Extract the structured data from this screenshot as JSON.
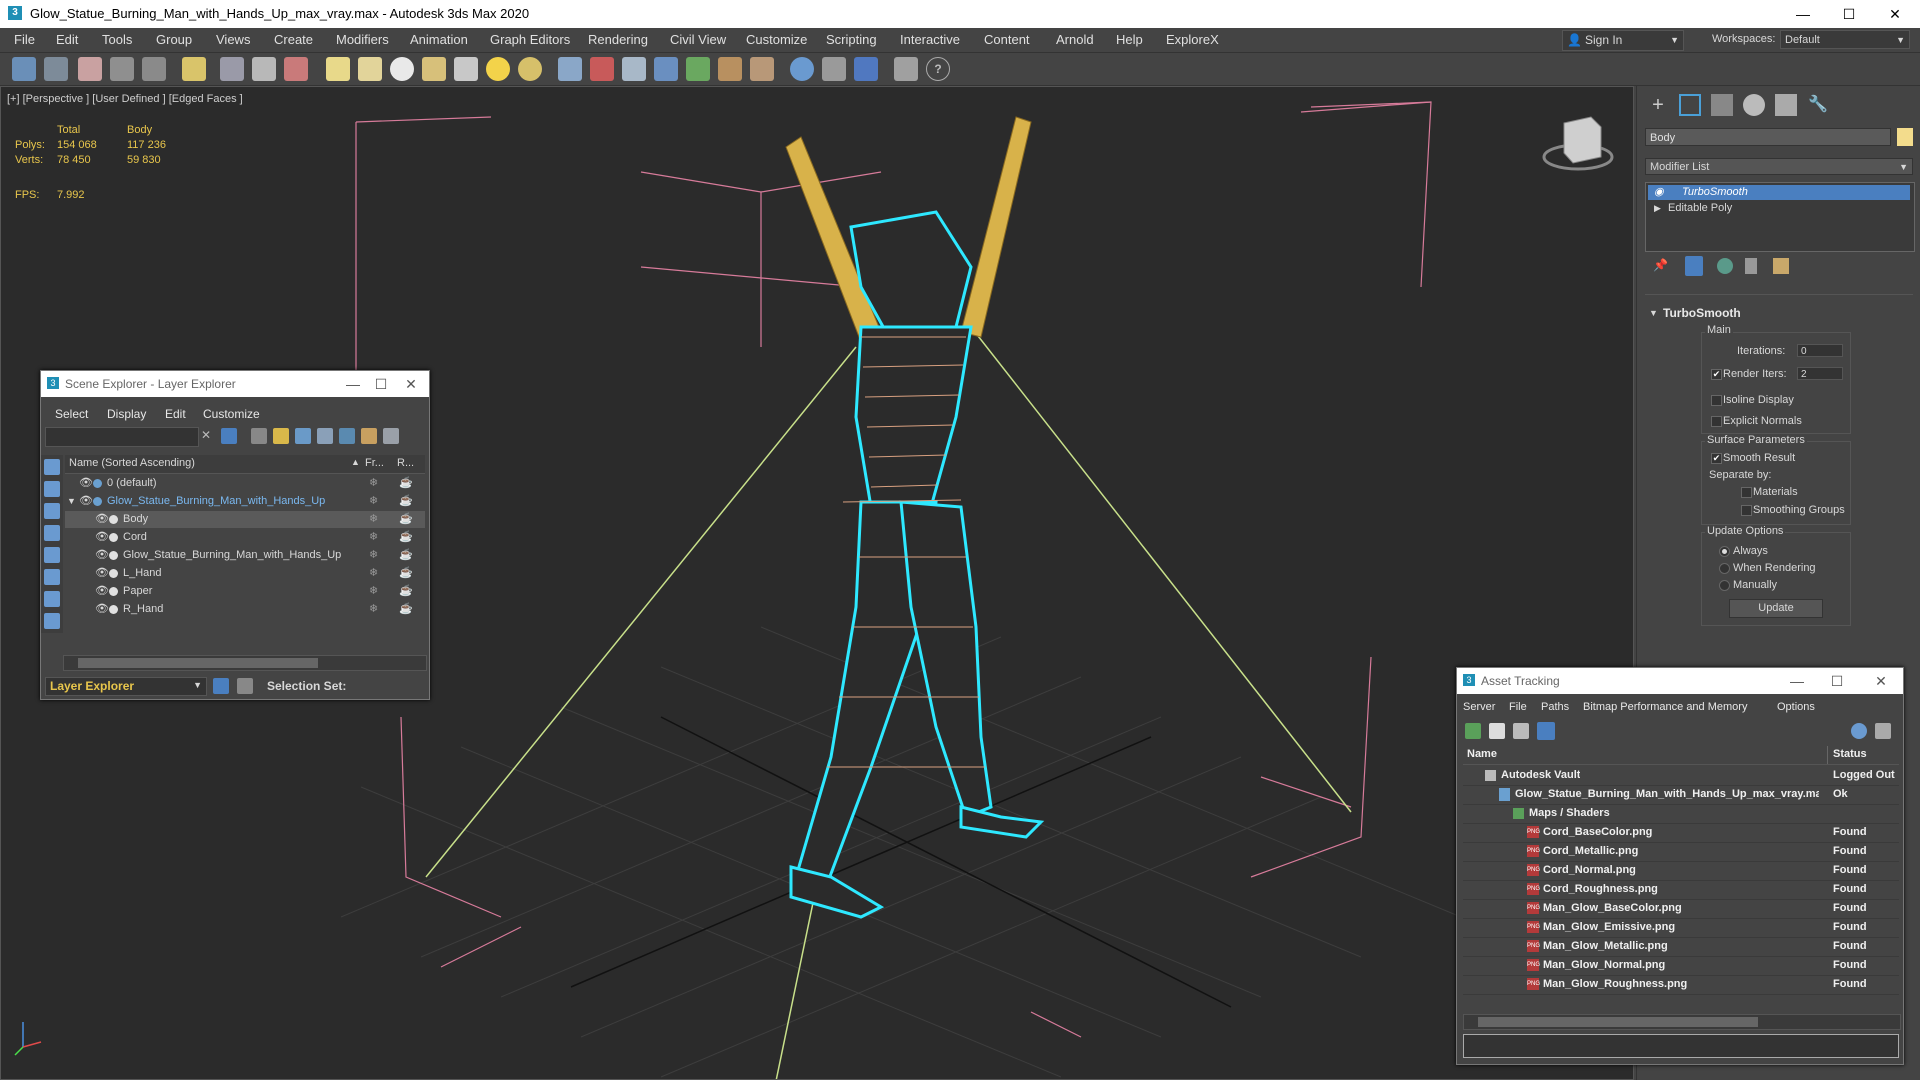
{
  "window": {
    "title": "Glow_Statue_Burning_Man_with_Hands_Up_max_vray.max - Autodesk 3ds Max 2020",
    "min": "—",
    "max": "☐",
    "close": "✕"
  },
  "menu": [
    "File",
    "Edit",
    "Tools",
    "Group",
    "Views",
    "Create",
    "Modifiers",
    "Animation",
    "Graph Editors",
    "Rendering",
    "Civil View",
    "Customize",
    "Scripting",
    "Interactive",
    "Content",
    "Arnold",
    "Help",
    "ExploreX"
  ],
  "account": {
    "sign_in": "Sign In",
    "workspaces_label": "Workspaces:",
    "workspace": "Default"
  },
  "viewport": {
    "label": "[+] [Perspective ] [User Defined ] [Edged Faces ]",
    "stats": {
      "col_total": "Total",
      "col_body": "Body",
      "polys_label": "Polys:",
      "polys_total": "154 068",
      "polys_body": "117 236",
      "verts_label": "Verts:",
      "verts_total": "78 450",
      "verts_body": "59 830",
      "fps_label": "FPS:",
      "fps": "7.992"
    }
  },
  "command_panel": {
    "object_name": "Body",
    "object_color": "#f3dc8c",
    "modifier_list": "Modifier List",
    "stack": [
      "TurboSmooth",
      "Editable Poly"
    ],
    "rollout": "TurboSmooth",
    "main": {
      "label": "Main",
      "iterations_label": "Iterations:",
      "iterations": "0",
      "render_iters_label": "Render Iters:",
      "render_iters": "2",
      "isoline": "Isoline Display",
      "explicit_normals": "Explicit Normals"
    },
    "surface": {
      "label": "Surface Parameters",
      "smooth_result": "Smooth Result",
      "separate_by": "Separate by:",
      "materials": "Materials",
      "smoothing_groups": "Smoothing Groups"
    },
    "update": {
      "label": "Update Options",
      "always": "Always",
      "when_rendering": "When Rendering",
      "manually": "Manually",
      "button": "Update"
    }
  },
  "scene_explorer": {
    "title": "Scene Explorer - Layer Explorer",
    "menu": [
      "Select",
      "Display",
      "Edit",
      "Customize"
    ],
    "columns": {
      "name": "Name (Sorted Ascending)",
      "frozen": "Fr...",
      "render": "R..."
    },
    "rows": [
      {
        "name": "0 (default)",
        "level": 0
      },
      {
        "name": "Glow_Statue_Burning_Man_with_Hands_Up",
        "level": 0
      },
      {
        "name": "Body",
        "level": 1
      },
      {
        "name": "Cord",
        "level": 1
      },
      {
        "name": "Glow_Statue_Burning_Man_with_Hands_Up",
        "level": 1
      },
      {
        "name": "L_Hand",
        "level": 1
      },
      {
        "name": "Paper",
        "level": 1
      },
      {
        "name": "R_Hand",
        "level": 1
      }
    ],
    "footer_explorer": "Layer Explorer",
    "selection_set": "Selection Set:"
  },
  "asset_tracking": {
    "title": "Asset Tracking",
    "menu": [
      "Server",
      "File",
      "Paths",
      "Bitmap Performance and Memory",
      "Options"
    ],
    "columns": {
      "name": "Name",
      "status": "Status"
    },
    "rows": [
      {
        "name": "Autodesk Vault",
        "status": "Logged Out",
        "indent": 0
      },
      {
        "name": "Glow_Statue_Burning_Man_with_Hands_Up_max_vray.max",
        "status": "Ok",
        "indent": 1
      },
      {
        "name": "Maps / Shaders",
        "status": "",
        "indent": 2
      },
      {
        "name": "Cord_BaseColor.png",
        "status": "Found",
        "indent": 3
      },
      {
        "name": "Cord_Metallic.png",
        "status": "Found",
        "indent": 3
      },
      {
        "name": "Cord_Normal.png",
        "status": "Found",
        "indent": 3
      },
      {
        "name": "Cord_Roughness.png",
        "status": "Found",
        "indent": 3
      },
      {
        "name": "Man_Glow_BaseColor.png",
        "status": "Found",
        "indent": 3
      },
      {
        "name": "Man_Glow_Emissive.png",
        "status": "Found",
        "indent": 3
      },
      {
        "name": "Man_Glow_Metallic.png",
        "status": "Found",
        "indent": 3
      },
      {
        "name": "Man_Glow_Normal.png",
        "status": "Found",
        "indent": 3
      },
      {
        "name": "Man_Glow_Roughness.png",
        "status": "Found",
        "indent": 3
      }
    ]
  }
}
